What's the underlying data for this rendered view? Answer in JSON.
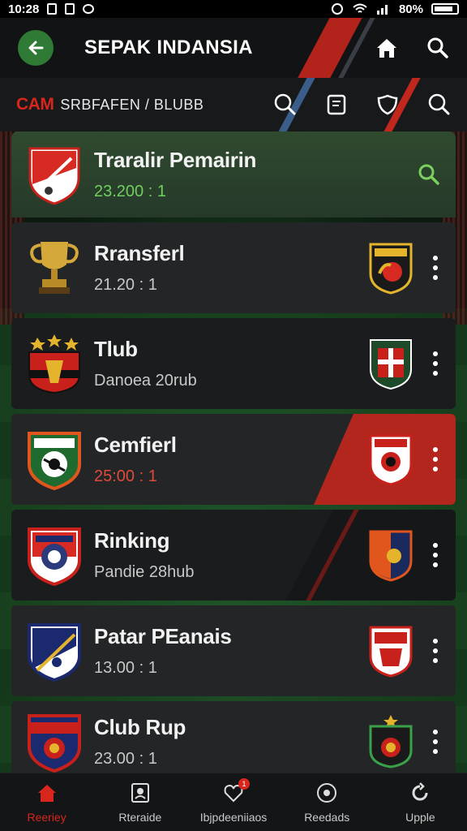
{
  "status_bar": {
    "time": "10:28",
    "battery": "80%"
  },
  "app_bar": {
    "title": "SEPAK INDANSIA"
  },
  "sub_bar": {
    "brand": "CAM",
    "title": "SRBFAFEN / BLUBB"
  },
  "colors": {
    "accent_red": "#d8261d",
    "accent_green": "#2f7a35",
    "card": "#232527"
  },
  "list": [
    {
      "name": "Traralir Pemairin",
      "meta": "23.200 : 1",
      "meta_style": "green",
      "crest": "shield-red-white",
      "right": "search"
    },
    {
      "name": "Rransferl",
      "meta": "21.20 : 1",
      "meta_style": "plain",
      "crest": "trophy",
      "right_crest": "yellow-black"
    },
    {
      "name": "Tlub",
      "meta": "Danoea 20rub",
      "meta_style": "plain",
      "crest": "stars-red-black",
      "right_crest": "green-cross"
    },
    {
      "name": "Cemfierl",
      "meta": "25:00 : 1",
      "meta_style": "red",
      "crest": "green-orange-ball",
      "right_crest": "red-white-ball"
    },
    {
      "name": "Rinking",
      "meta": "Pandie 28hub",
      "meta_style": "plain",
      "crest": "red-navy-ball",
      "right_crest": "orange-navy"
    },
    {
      "name": "Patar PEanais",
      "meta": "13.00 : 1",
      "meta_style": "plain",
      "crest": "navy-white",
      "right_crest": "red-white-crest"
    },
    {
      "name": "Club Rup",
      "meta": "23.00 : 1",
      "meta_style": "plain",
      "crest": "red-navy-banner",
      "right_crest": "green-black-star"
    }
  ],
  "bottom_nav": [
    {
      "label": "Reeriey",
      "icon": "home-icon"
    },
    {
      "label": "Rteraide",
      "icon": "profile-card-icon"
    },
    {
      "label": "Ibjpdeeniiaos",
      "icon": "heart-shield-icon",
      "badge": "1"
    },
    {
      "label": "Reedads",
      "icon": "ball-icon"
    },
    {
      "label": "Upple",
      "icon": "refresh-icon"
    }
  ]
}
